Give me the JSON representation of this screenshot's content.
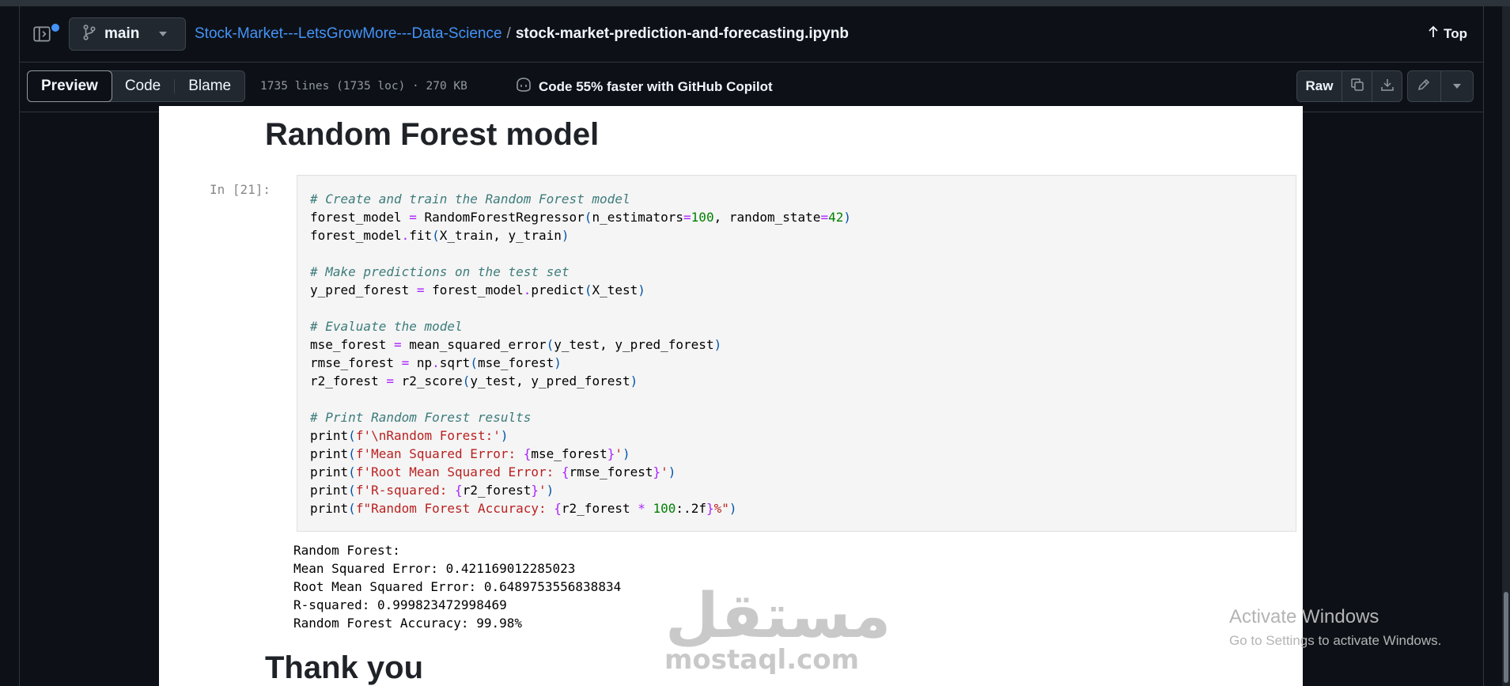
{
  "header": {
    "branch": "main",
    "repo_link": "Stock-Market---LetsGrowMore---Data-Science",
    "separator": "/",
    "file_name": "stock-market-prediction-and-forecasting.ipynb",
    "top_label": "Top"
  },
  "toolbar": {
    "tabs": [
      "Preview",
      "Code",
      "Blame"
    ],
    "active_tab": "Preview",
    "file_info": "1735 lines (1735 loc) · 270 KB",
    "copilot_text": "Code 55% faster with GitHub Copilot",
    "raw_label": "Raw",
    "icons": [
      "copy-icon",
      "download-icon",
      "pencil-icon",
      "chevron-down-icon"
    ]
  },
  "notebook": {
    "heading": "Random Forest model",
    "prompt": "In [21]:",
    "code_lines": [
      "# Create and train the Random Forest model",
      "forest_model = RandomForestRegressor(n_estimators=100, random_state=42)",
      "forest_model.fit(X_train, y_train)",
      "",
      "# Make predictions on the test set",
      "y_pred_forest = forest_model.predict(X_test)",
      "",
      "# Evaluate the model",
      "mse_forest = mean_squared_error(y_test, y_pred_forest)",
      "rmse_forest = np.sqrt(mse_forest)",
      "r2_forest = r2_score(y_test, y_pred_forest)",
      "",
      "# Print Random Forest results",
      "print(f'\\nRandom Forest:')",
      "print(f'Mean Squared Error: {mse_forest}')",
      "print(f'Root Mean Squared Error: {rmse_forest}')",
      "print(f'R-squared: {r2_forest}')",
      "print(f\"Random Forest Accuracy: {r2_forest * 100:.2f}%\")"
    ],
    "output": "Random Forest:\nMean Squared Error: 0.421169012285023\nRoot Mean Squared Error: 0.6489753556838834\nR-squared: 0.999823472998469\nRandom Forest Accuracy: 99.98%",
    "next_heading": "Thank you"
  },
  "overlays": {
    "watermark_ar": "مستقل",
    "watermark_en": "mostaql.com",
    "activate_title": "Activate Windows",
    "activate_sub": "Go to Settings to activate Windows."
  },
  "colors": {
    "background": "#0d1117",
    "link": "#4493f8",
    "notebook_bg": "#ffffff",
    "code_bg": "#f5f5f5",
    "comment": "#3d7b7b",
    "number": "#008000",
    "string": "#ba2121",
    "operator": "#aa22ff"
  }
}
